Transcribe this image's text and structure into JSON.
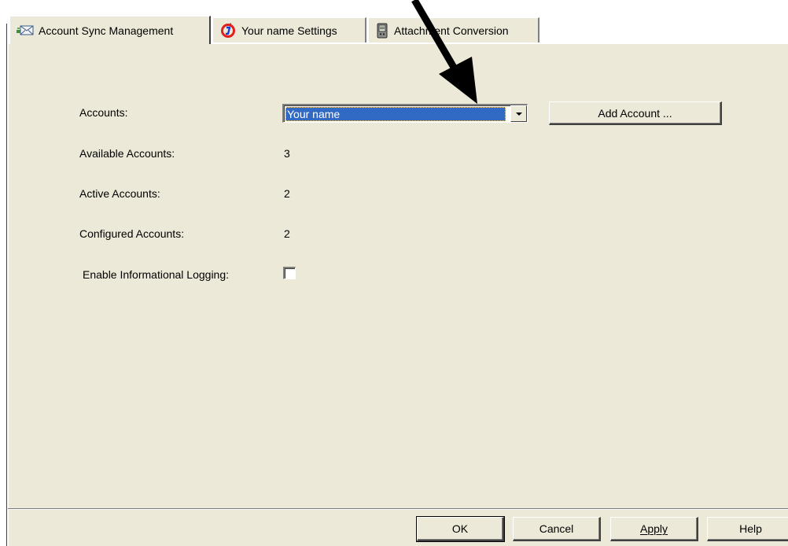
{
  "tabs": [
    {
      "label": "Account Sync Management",
      "icon": "mail-icon",
      "active": true
    },
    {
      "label": "Your name Settings",
      "icon": "sync-icon",
      "active": false
    },
    {
      "label": "Attachment Conversion",
      "icon": "handheld-icon",
      "active": false
    }
  ],
  "fields": {
    "accounts_label": "Accounts:",
    "accounts_value": "Your name",
    "add_account_label": "Add Account ...",
    "available_label": "Available Accounts:",
    "available_value": "3",
    "active_label": "Active Accounts:",
    "active_value": "2",
    "configured_label": "Configured Accounts:",
    "configured_value": "2",
    "logging_label": "Enable Informational Logging:",
    "logging_checked": false
  },
  "footer": {
    "ok_label": "OK",
    "cancel_label": "Cancel",
    "apply_label": "Apply",
    "help_label": "Help"
  },
  "colors": {
    "dialog_bg": "#ece9d8",
    "selection": "#316ac5",
    "sync_icon_red": "#e0201c",
    "sync_icon_blue": "#1c3ccc"
  },
  "annotation": {
    "type": "arrow",
    "color": "#000000",
    "points_to": "accounts-dropdown"
  }
}
